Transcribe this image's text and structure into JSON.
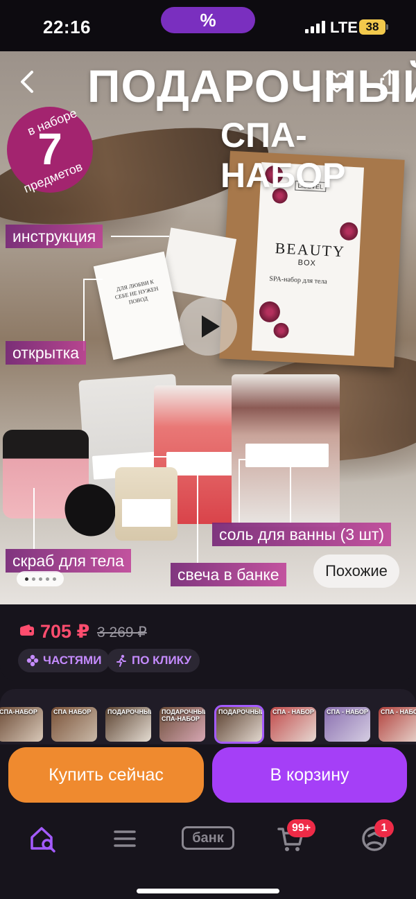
{
  "status_bar": {
    "time": "22:16",
    "promo_symbol": "%",
    "network": "LTE",
    "battery": "38"
  },
  "hero": {
    "headline_line1": "ПОДАРОЧНЫЙ",
    "headline_line2": "СПА-НАБОР",
    "badge": {
      "top": "в наборе",
      "number": "7",
      "bottom": "предметов"
    },
    "tags": {
      "instruction": "инструкция",
      "card": "открытка",
      "scrub": "скраб для тела",
      "candle": "свеча в банке",
      "salt": "соль для ванны (3 шт)"
    },
    "box": {
      "brand": "LISEVEL",
      "title": "BEAUTY",
      "subtitle": "BOX",
      "description": "SPA-набор для тела"
    },
    "card_text": "ДЛЯ ЛЮБВИ К СЕБЕ НЕ НУЖЕН ПОВОД",
    "similar_button": "Похожие",
    "gallery_dots": 5,
    "gallery_active_index": 0
  },
  "price": {
    "current": "705 ₽",
    "old": "3 269 ₽",
    "chips": {
      "parts": "ЧАСТЯМИ",
      "one_click": "ПО КЛИКУ"
    }
  },
  "thumbnails": [
    {
      "label": "СПА-НАБОР"
    },
    {
      "label": "СПА НАБОР"
    },
    {
      "label": "ПОДАРОЧНЫЙ"
    },
    {
      "label": "ПОДАРОЧНЫЙ СПА-НАБОР"
    },
    {
      "label": "ПОДАРОЧНЫЙ"
    },
    {
      "label": "СПА - НАБОР"
    },
    {
      "label": "СПА - НАБОР"
    },
    {
      "label": "СПА - НАБОР"
    }
  ],
  "actions": {
    "buy_now": "Купить сейчас",
    "add_to_cart": "В корзину"
  },
  "bottom_nav": {
    "bank_label": "банк",
    "cart_badge": "99+",
    "profile_badge": "1"
  },
  "colors": {
    "accent_purple": "#a53ff7",
    "buy_orange": "#ef8a2f",
    "price_red": "#ff4d6e",
    "badge_red": "#ee2b47"
  }
}
